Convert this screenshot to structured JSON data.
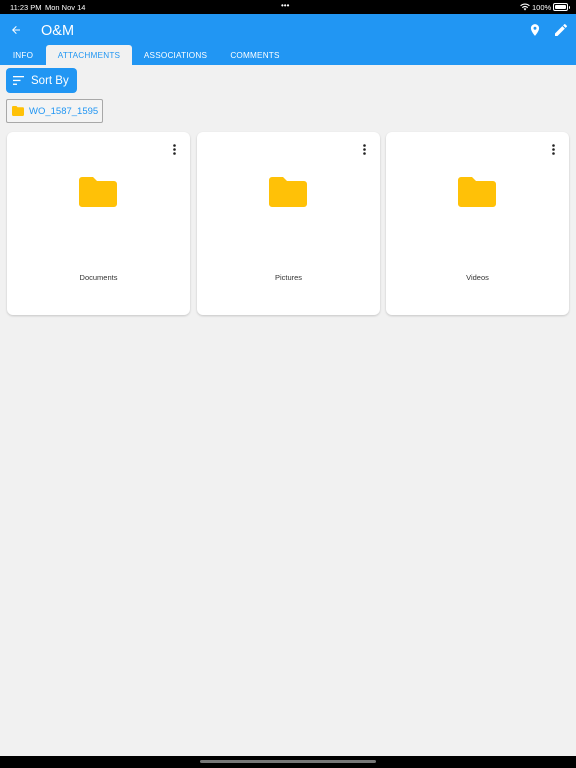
{
  "status_bar": {
    "time": "11:23 PM",
    "date": "Mon Nov 14",
    "multitask_dots": "•••",
    "battery_text": "100%",
    "wifi_icon": "wifi-icon",
    "battery_icon": "battery-icon"
  },
  "app_bar": {
    "title": "O&M",
    "back_icon": "arrow-back-icon",
    "location_icon": "location-pin-icon",
    "edit_icon": "pencil-icon",
    "color": "#2196f3"
  },
  "tabs": [
    {
      "label": "INFO",
      "active": false
    },
    {
      "label": "ATTACHMENTS",
      "active": true
    },
    {
      "label": "ASSOCIATIONS",
      "active": false
    },
    {
      "label": "COMMENTS",
      "active": false
    }
  ],
  "toolbar": {
    "sort_label": "Sort By",
    "sort_icon": "sort-icon"
  },
  "breadcrumb": {
    "label": "WO_1587_1595",
    "icon": "folder-icon"
  },
  "folders": [
    {
      "name": "Documents",
      "icon": "folder-icon"
    },
    {
      "name": "Pictures",
      "icon": "folder-icon"
    },
    {
      "name": "Videos",
      "icon": "folder-icon"
    }
  ],
  "colors": {
    "accent": "#2196f3",
    "folder": "#ffc107",
    "background": "#f1f1f1"
  }
}
